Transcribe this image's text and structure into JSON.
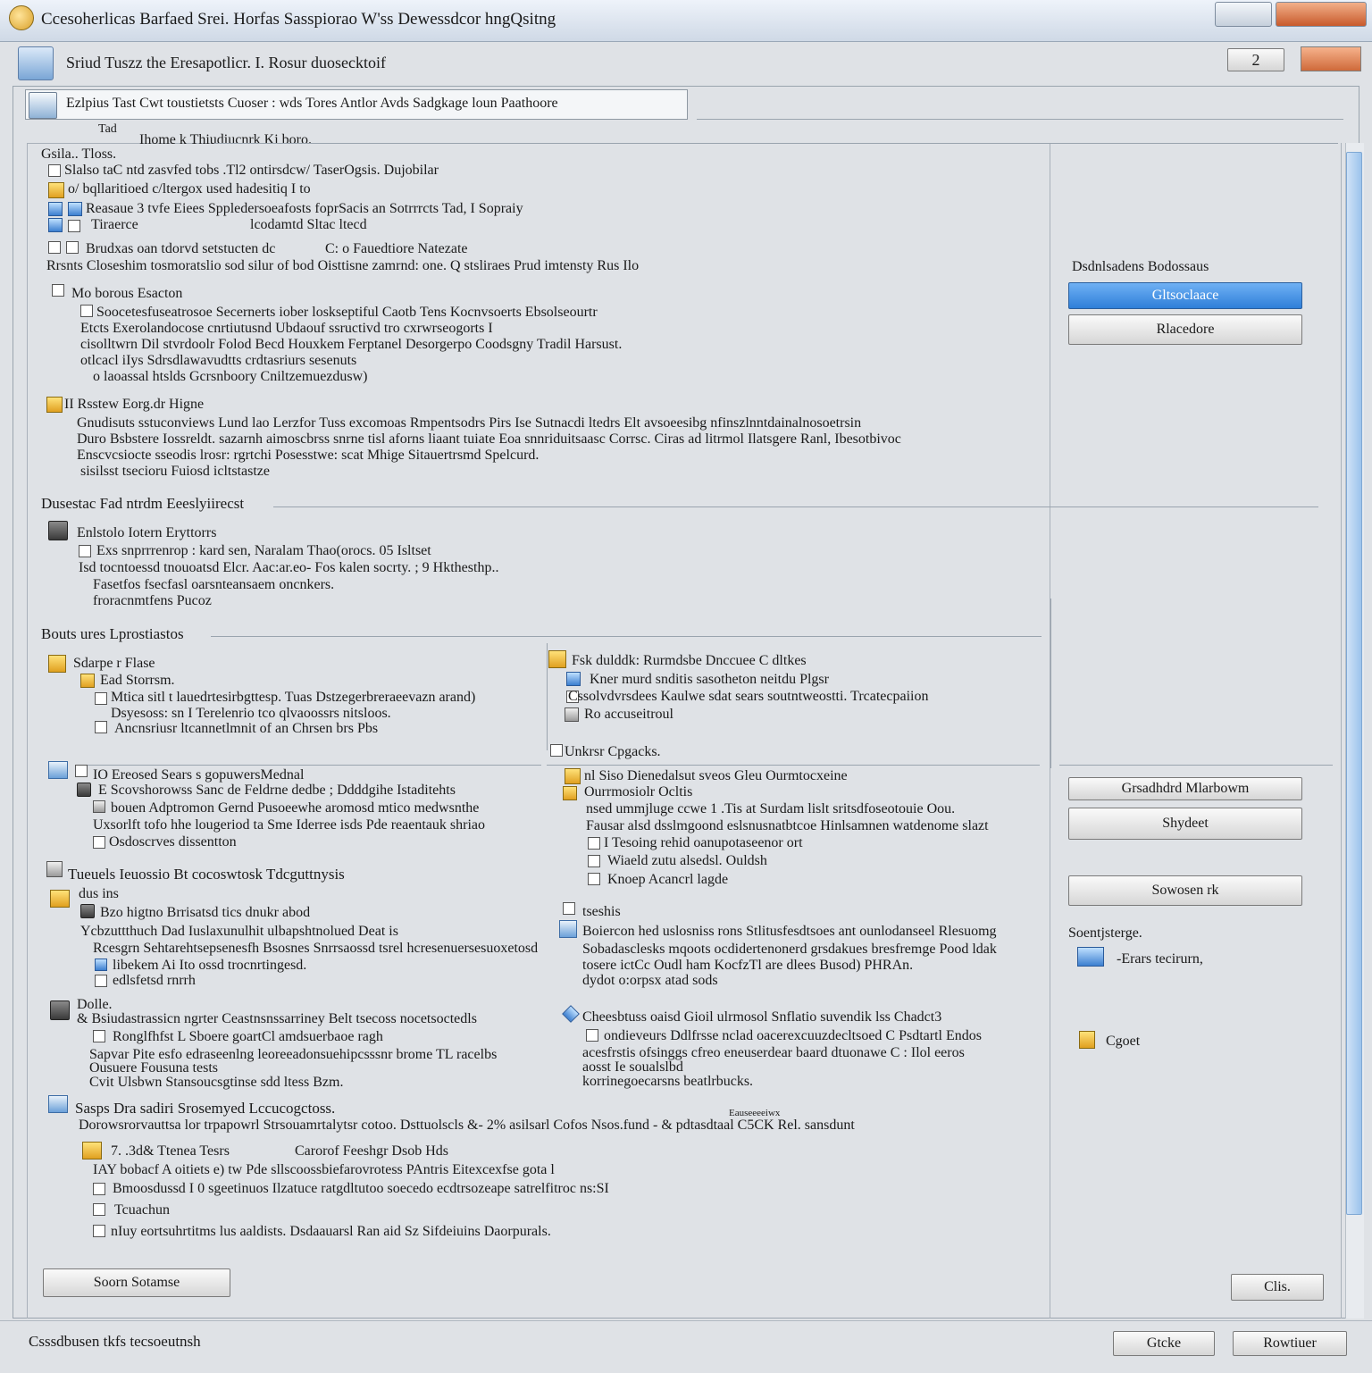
{
  "window": {
    "title": "Ccesoherlicas Barfaed Srei. Horfas Sasspiorao W'ss Dewessdcor hngQsitng",
    "header_text": "Sriud Tuszz the Eresapotlicr.  I. Rosur duosecktoif",
    "header_button_label": "2"
  },
  "address_bar": {
    "text": "Ezlpius Tast Cwt toustietsts  Cuoser : wds  Tores  Antlor  Avds  Sadgkage  loun Paathoore"
  },
  "content": {
    "caption_top": "Tad",
    "header_line": "Ihome  k Thiudiucnrk Ki boro.",
    "group1": {
      "title": "Gsila.. Tloss.",
      "lines": [
        "Slalso taC ntd zasvfed tobs  .Tl2  ontirsdcw/ TaserOgsis. Dujobilar",
        "o/  bqllaritioed  c/ltergox used     hadesitiq     I   to",
        "Reasaue  3  tvfe  Eiees  Sppledersoeafosts  foprSacis   an  Sotrrrcts  Tad,  I  Sopraiy",
        "Tiraerce",
        "lcodamtd Sltac ltecd"
      ]
    },
    "group2": {
      "line1": "Brudxas  oan tdorvd  setstucten  dc",
      "line1b": "C: o  Fauedtiore  Natezate",
      "line2": "Rrsnts  Closeshim  tosmoratslio sod  silur of bod  Oisttisne  zamrnd:  one.  Q  stsliraes  Prud  imtensty  Rus  Ilo"
    },
    "group3": {
      "title": "Mo borous  Esacton",
      "lines": [
        "Soocetesfuseatrosoe  Secernerts  iober  loskseptiful  Caotb   Tens  Kocnvsoerts  Ebsolseourtr",
        "Etcts  Exerolandocose  cnrtiutusnd  Ubdaouf  ssructivd  tro  cxrwrseogorts  I",
        "cisolltwrn  Dil  stvrdoolr  Folod  Becd  Houxkem  Ferptanel  Desorgerpo  Coodsgny  Tradil  Harsust.",
        "otlcacl  iIys   Sdrsdlawavudtts  crdtasriurs               sesenuts",
        "o  laoassal  htslds  Gcrsnboory  Cniltzemuezdusw)"
      ]
    },
    "group4": {
      "title": "II  Rsstew  Eorg.dr  Higne",
      "lines": [
        "Gnudisuts  sstuconviews  Lund  lao  Lerzfor   Tuss  excomoas  Rmpentsodrs  Pirs  Ise  Sutnacdi  ltedrs  Elt  avsoeesibg  nfinszlnntdainalnosoetrsin",
        "Duro  Bsbstere  Iossreldt.  sazarnh  aimoscbrss  snrne  tisl  aforns  liaant  tuiate  Eoa  snnriduitsaasc  Corrsc.  Ciras  ad  litrmol  Ilatsgere  Ranl,  Ibesotbivoc",
        "Enscvcsiocte   sseodis  lrosr:  rgrtchi   Posesstwe:  scat   Mhige  Sitauertrsmd  Spelcurd.",
        "sisilsst  tsecioru  Fuiosd  icltstastze"
      ]
    },
    "section_dusc": {
      "title": "Dusestac  Fad  ntrdm  Eeeslyiirecst",
      "item_title": "Enlstolo  Iotern  Eryttorrs",
      "lines": [
        "Exs  snprrrenrop :  kard  sen,  Naralam   Thao(orocs.  05  Isltset",
        "Isd  tocntoessd  tnouoatsd  Elcr.  Aac:ar.eo-  Fos  kalen  socrty.  ;  9  Hkthesthp..",
        "Fasetfos  fsecfasl  oarsnteansaem  oncnkers.",
        "froracnmtfens  Pucoz"
      ]
    },
    "section_bouts": {
      "title": "Bouts  ures  Lprostiastos",
      "left": {
        "g1_title": "Sdarpe  r Flase",
        "g1_lines": [
          "Ead  Storrsm.",
          "Mtica  sitl  t lauedrtesirbgttesp.  Tuas  Dstzegerbreraeevazn  arand)",
          "Dsyesoss:  sn  I  Terelenrio  tco  qlvaoossrs  nitsloos.",
          "Ancnsriusr  ltcannetlmnit  of  an  Chrsen  brs Pbs"
        ],
        "g2_title": "IO  Ereosed  Sears  s  gopuwersMednal",
        "g2_lines": [
          "E   Scovshorowss  Sanc  de  Feldrne   dedbe  ;  Ddddgihe  Istaditehts",
          "bouen  Adptromon  Gernd  Pusoeewhe  aromosd  mtico  medwsnthe",
          "Uxsorlft  tofo  hhe  lougeriod  ta  Sme  Iderree  isds  Pde  reaentauk  shriao",
          "Osdoscrves  dissentton"
        ],
        "g3_title": "Tueuels  Ieuossio  Bt  cocoswtosk  Tdcguttnysis",
        "g3_lines": [
          "dus  ins",
          "Bzo  higtno  Brrisatsd  tics  dnukr  abod",
          "Ycbzuttthuch  Dad  Iuslaxunulhit  ulbapshtnolued   Deat  is",
          "Rcesgrn Sehtarehtsepsenesfh  Bsosnes  Snrrsaossd  tsrel  hcresenuersesuoxetosd",
          "libekem  Ai  Ito  ossd  trocnrtingesd.",
          "edlsfetsd  rnrrh"
        ],
        "g4_title": "Dolle.",
        "g4_lines": [
          "&  Bsiudastrassicn  ngrter  Ceastnsnssarriney  Belt tsecoss  nocetsoctedls",
          "Ronglfhfst  L     Sboere  goartCl  amdsuerbaoe  ragh",
          "Sapvar  Pite  esfo  edraseenlng  leoreeadonsuehipcsssnr  brome  TL  racelbs",
          "Ousuere  Fousuna  tests",
          "Cvit  Ulsbwn  Stansoucsgtinse  sdd  ltess  Bzm."
        ]
      },
      "right": {
        "g1_title": "Fsk  dulddk:  Rurmdsbe  Dnccuee  C dltkes",
        "g1_lines": [
          "Kner  murd  snditis  sasotheton  neitdu  Plgsr",
          "Cssolvdvrsdees  Kaulwe  sdat  sears  soutntweostti.   Trcatecpaiion",
          "Ro  accuseitroul"
        ],
        "g2_title": "Unkrsr  Cpgacks.",
        "g2_lines": [
          "nl  Siso   Dienedalsut  sveos  Gleu  Ourmtocxeine",
          "Ourrmosiolr  Ocltis",
          "nsed  ummjluge  ccwe  1  .Tis  at  Surdam  lislt  sritsdfoseotouie  Oou.",
          "Fausar  alsd  dsslmgoond  eslsnusnatbtcoe  Hinlsamnen  watdenome  slazt",
          "I  Tesoing  rehid  oanupotaseenor  ort",
          "Wiaeld  zutu  alsedsl.  Ouldsh",
          "Knoep  Acancrl  lagde"
        ],
        "g3_title": "tseshis",
        "g3_lines": [
          "Boiercon  hed  uslosniss  rons  Stlitusfesdtsoes  ant  ounlodanseel  Rlesuomg",
          "Sobadasclesks  mqoots  ocdidertenonerd  grsdakues  bresfremge  Pood  ldak",
          "tosere  ictCc  Oudl  ham  KocfzTl  are  dlees  Busod)  PHRAn.",
          "dydot  o:orpsx  atad  sods"
        ],
        "g4_title": "Cheesbtuss  oaisd  Gioil  ulrmosol  Snflatio  suvendik  lss  Chadct3",
        "g4_lines": [
          "ondieveurs   Ddlfrsse  nclad  oacerexcuuzdecltsoed  C  Psdtartl  Endos",
          "acesfrstis  ofsinggs  cfreo  eneuserdear  baard  dtuonawe  C  :  Ilol  eeros",
          "aosst  Ie  soualslbd",
          "korrinegoecarsns  beatlrbucks."
        ]
      },
      "bottom": {
        "g1_title": "Sasps  Dra  sadiri  Srosemyed  Lccucogctoss.",
        "g1_small": "Eauseeeeiwx",
        "g1_line": "Dorowsrorvauttsa  lor  trpapowrl  Strsouamrtalytsr  cotoo.  Dsttuolscls  &-  2%  asilsarl  Cofos  Nsos.fund  -  &  pdtasdtaal  C5CK  Rel.  sansdunt",
        "row_title_a": "7.  .3d&  Ttenea  Tesrs",
        "row_title_b": "Carorof  Feeshgr  Dsob  Hds",
        "lines": [
          "IAY  bobacf A  oitiets  e)  tw  Pde  sllscoossbiefarovrotess   PAntris Eitexcexfse  gota l",
          "Bmoosdussd  I  0  sgeetinuos  Ilzatuce  ratgdltutoo  soecedo  ecdtrsozeape  satrelfitroc  ns:SI",
          "Tcuachun",
          "nIuy  eortsuhrtitms  lus  aaldists.   Dsdaauarsl  Ran  aid  Sz  Sifdeiuins  Daorpurals."
        ]
      }
    },
    "bottom_left_button": "Soorn  Sotamse"
  },
  "side_panel": {
    "heading": "Dsdnlsadens  Bodossaus",
    "primary_button": "Gltsoclaace",
    "button2": "Rlacedore",
    "button3": "Grsadhdrd  Mlarbowm",
    "button4": "Shydeet",
    "button5": "Sowosen  rk",
    "section_label": "Soentjsterge.",
    "item_blue": "-Erars  tecirurn,",
    "item_yellow": "Cgoet",
    "close_button": "Clis."
  },
  "status": {
    "text": "Csssdbusen  tkfs  tecsoeutnsh",
    "button_left": "Gtcke",
    "button_right": "Rowtiuer"
  }
}
